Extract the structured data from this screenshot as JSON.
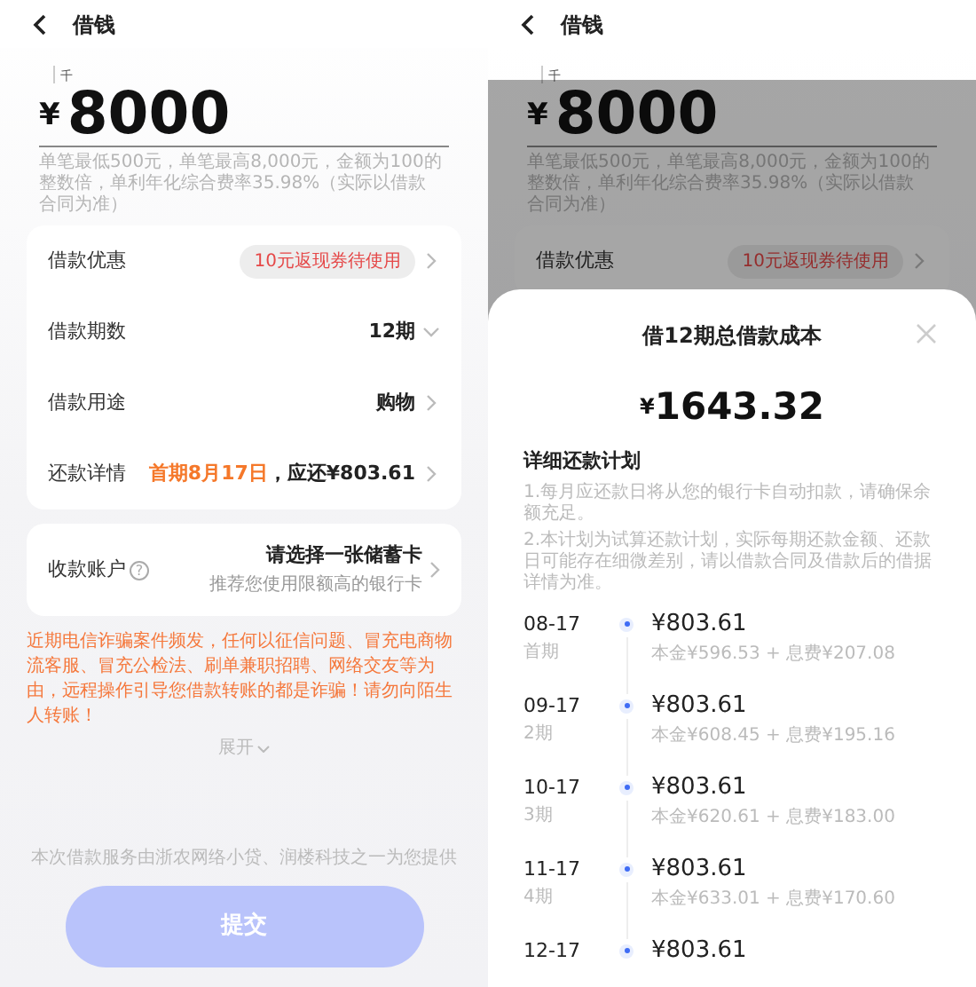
{
  "screens": [
    {
      "header": {
        "title": "借钱"
      },
      "amount": {
        "unit_hint": "千",
        "currency": "¥",
        "value": "8000"
      },
      "note": "单笔最低500元，单笔最高8,000元，金额为100的整数倍，单利年化综合费率35.98%（实际以借款合同为准）",
      "rows": [
        {
          "kind": "coupon",
          "label": "借款优惠",
          "value": "10元返现券待使用"
        },
        {
          "kind": "dropdown",
          "label": "借款期数",
          "value": "12期"
        },
        {
          "kind": "link",
          "label": "借款用途",
          "value": "购物"
        },
        {
          "kind": "repayment",
          "label": "还款详情",
          "highlight": "首期8月17日",
          "value": "，应还¥803.61"
        }
      ],
      "account": {
        "label": "收款账户",
        "help": "?",
        "value": "请选择一张储蓄卡",
        "hint": "推荐您使用限额高的银行卡"
      },
      "warning": "近期电信诈骗案件频发，任何以征信问题、冒充电商物流客服、冒充公检法、刷单兼职招聘、网络交友等为由，远程操作引导您借款转账的都是诈骗！请勿向陌生人转账！",
      "expand": "展开",
      "provider": "本次借款服务由浙农网络小贷、润楼科技之一为您提供",
      "submit": {
        "label": "提交",
        "disabled": true
      }
    },
    {
      "dimmed": true,
      "header": {
        "title": "借钱"
      },
      "amount": {
        "unit_hint": "千",
        "currency": "¥",
        "value": "8000"
      },
      "note": "单笔最低500元，单笔最高8,000元，金额为100的整数倍，单利年化综合费率35.98%（实际以借款合同为准）",
      "rows": [
        {
          "kind": "coupon",
          "label": "借款优惠",
          "value": "10元返现券待使用"
        }
      ],
      "sheet": {
        "title": "借12期总借款成本",
        "currency": "¥",
        "total": "1643.32",
        "plan_title": "详细还款计划",
        "notes": [
          "1.每月应还款日将从您的银行卡自动扣款，请确保余额充足。",
          "2.本计划为试算还款计划，实际每期还款金额、还款日可能存在细微差别，请以借款合同及借款后的借据详情为准。"
        ],
        "schedule": [
          {
            "date": "08-17",
            "period": "首期",
            "amount": "¥803.61",
            "breakdown": "本金¥596.53 + 息费¥207.08"
          },
          {
            "date": "09-17",
            "period": "2期",
            "amount": "¥803.61",
            "breakdown": "本金¥608.45 + 息费¥195.16"
          },
          {
            "date": "10-17",
            "period": "3期",
            "amount": "¥803.61",
            "breakdown": "本金¥620.61 + 息费¥183.00"
          },
          {
            "date": "11-17",
            "period": "4期",
            "amount": "¥803.61",
            "breakdown": "本金¥633.01 + 息费¥170.60"
          },
          {
            "date": "12-17",
            "amount": "¥803.61"
          }
        ]
      }
    }
  ]
}
